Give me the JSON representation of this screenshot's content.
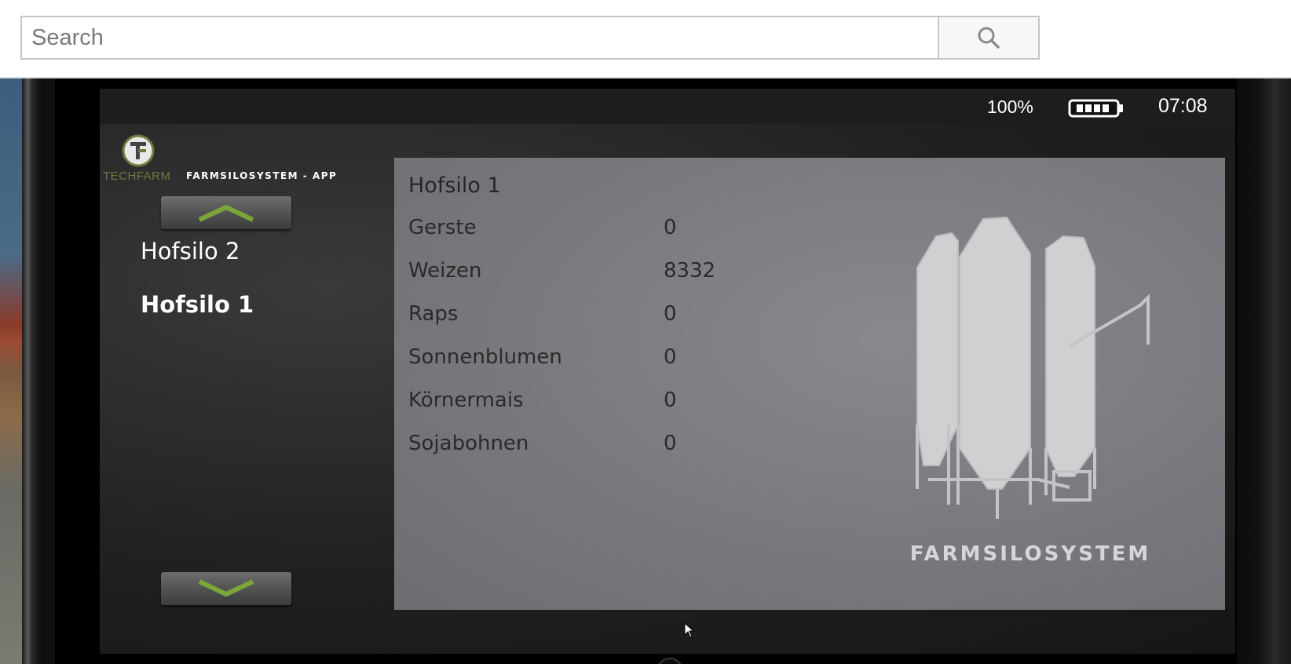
{
  "search": {
    "placeholder": "Search",
    "button_icon": "search-icon"
  },
  "status_bar": {
    "battery_percent": "100%",
    "battery_level": 1.0,
    "battery_icon": "battery-icon",
    "time": "07:08"
  },
  "sidebar": {
    "logo_icon": "techfarm-logo",
    "brand": "TECHFARM",
    "app_name": "FARMSILOSYSTEM - APP",
    "up_icon": "chevron-up-icon",
    "down_icon": "chevron-down-icon",
    "items": [
      {
        "label": "Hofsilo 2",
        "active": false
      },
      {
        "label": "Hofsilo 1",
        "active": true
      }
    ]
  },
  "detail": {
    "title": "Hofsilo 1",
    "grains": [
      {
        "name": "Gerste",
        "quantity": "0"
      },
      {
        "name": "Weizen",
        "quantity": "8332"
      },
      {
        "name": "Raps",
        "quantity": "0"
      },
      {
        "name": "Sonnenblumen",
        "quantity": "0"
      },
      {
        "name": "Körnermais",
        "quantity": "0"
      },
      {
        "name": "Sojabohnen",
        "quantity": "0"
      }
    ],
    "illustration_icon": "silo-illustration",
    "brand_label": "FARMSILOSYSTEM"
  },
  "colors": {
    "accent_green": "#7aa63a",
    "panel_gray": "#7a787d",
    "screen_dark": "#1d1d1d"
  }
}
